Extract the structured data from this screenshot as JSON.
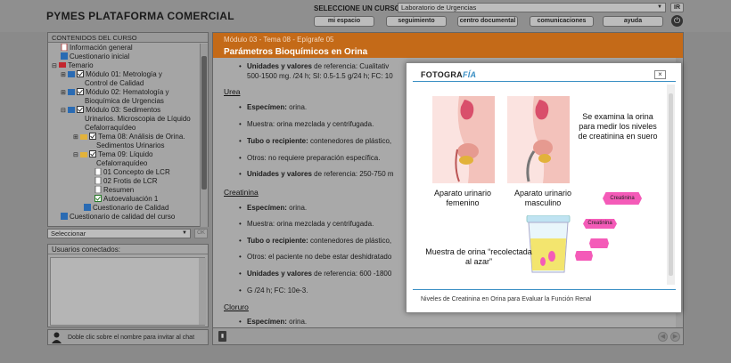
{
  "header": {
    "app_title": "PYMES PLATAFORMA COMERCIAL",
    "course_label": "SELECCIONE UN CURSO:",
    "course_value": "Laboratorio de Urgencias",
    "go_label": "IR",
    "nav": [
      {
        "label": "mi espacio"
      },
      {
        "label": "seguimiento"
      },
      {
        "label": "centro documental"
      },
      {
        "label": "comunicaciones"
      },
      {
        "label": "ayuda"
      }
    ]
  },
  "sidebar": {
    "title": "CONTENIDOS DEL CURSO",
    "items": [
      {
        "label": "Información general"
      },
      {
        "label": "Cuestionario inicial"
      },
      {
        "label": "Temario"
      },
      {
        "label": "Módulo 01: Metrología y"
      },
      {
        "label": "Control de Calidad"
      },
      {
        "label": "Módulo 02: Hematología y"
      },
      {
        "label": "Bioquímica de Urgencias"
      },
      {
        "label": "Módulo 03: Sedimentos"
      },
      {
        "label": "Urinarios. Microscopia de Líquido"
      },
      {
        "label": "Cefalorraquídeo"
      },
      {
        "label": "Tema 08: Análisis de Orina."
      },
      {
        "label": "Sedimentos Urinarios"
      },
      {
        "label": "Tema 09: Líquido"
      },
      {
        "label": "Cefalorraquídeo"
      },
      {
        "label": "01 Concepto de LCR"
      },
      {
        "label": "02 Frotis de LCR"
      },
      {
        "label": "Resumen"
      },
      {
        "label": "Autoevaluación 1"
      },
      {
        "label": "Cuestionario de Calidad"
      },
      {
        "label": "Cuestionario de calidad del curso"
      }
    ],
    "select_label": "Seleccionar",
    "ok_label": "OK"
  },
  "users": {
    "title": "Usuarios conectados:",
    "hint": "Doble clic sobre el nombre para invitar al chat"
  },
  "main": {
    "breadcrumb": "Módulo 03 - Tema 08 - Epígrafe 05",
    "title": "Parámetros Bioquímicos en Orina",
    "lines": {
      "l1a": "Unidades y valores",
      "l1b": " de referencia: Cualitativ",
      "l2": "500-1500 mg. /24 h; SI: 0.5-1.5 g/24 h; FC: 10",
      "urea": "Urea",
      "u1a": "Especímen:",
      "u1b": " orina.",
      "u2": "Muestra: orina mezclada y centrifugada.",
      "u3a": "Tubo o recipiente:",
      "u3b": " contenedores de plástico,",
      "u4": "Otros: no requiere preparación específica.",
      "u5a": "Unidades y valores",
      "u5b": " de referencia: 250-750 m",
      "creat": "Creatinina",
      "c1a": "Especímen:",
      "c1b": " orina.",
      "c2": "Muestra: orina mezclada y centrifugada.",
      "c3a": "Tubo o recipiente:",
      "c3b": " contenedores de plástico,",
      "c4": "Otros: el paciente no debe estar deshidratado",
      "c5a": "Unidades y valores",
      "c5b": " de referencia: 600 -1800",
      "c6": "G /24 h; FC: 10e-3.",
      "clor": "Cloruro",
      "k1a": "Especímen:",
      "k1b": " orina."
    }
  },
  "modal": {
    "logo_a": "FOTOGRA",
    "logo_b": "FÍA",
    "close": "×",
    "label_female": "Aparato urinario femenino",
    "label_male": "Aparato urinario masculino",
    "label_side": "Se examina la orina para medir los niveles de creatinina en suero",
    "label_sample": "Muestra de orina “recolectada al azar”",
    "pill_text": "Creatinina",
    "caption": "Niveles de Creatinina en Orina para Evaluar la Función Renal"
  }
}
